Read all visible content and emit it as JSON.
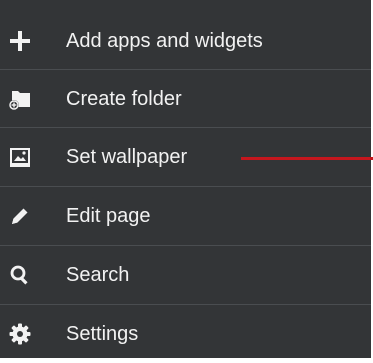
{
  "menu": {
    "items": [
      {
        "label": "Add apps and widgets",
        "icon": "plus-icon"
      },
      {
        "label": "Create folder",
        "icon": "folder-add-icon"
      },
      {
        "label": "Set wallpaper",
        "icon": "wallpaper-icon"
      },
      {
        "label": "Edit page",
        "icon": "pencil-icon"
      },
      {
        "label": "Search",
        "icon": "search-icon"
      },
      {
        "label": "Settings",
        "icon": "gear-icon"
      }
    ]
  },
  "colors": {
    "background": "#333537",
    "divider": "#4a4d50",
    "text": "#f2f2f2",
    "annotation": "#c5161d"
  }
}
